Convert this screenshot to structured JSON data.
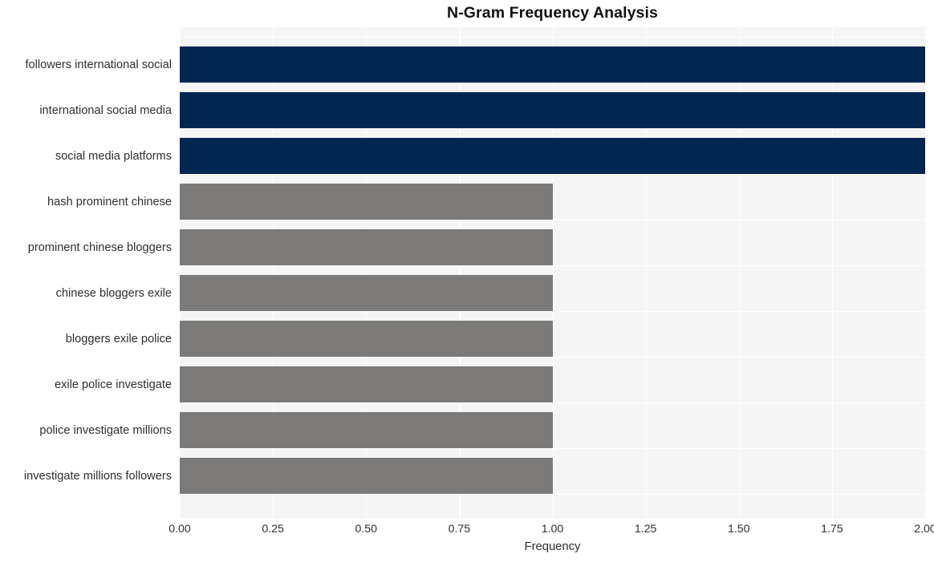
{
  "chart_data": {
    "type": "bar",
    "orientation": "horizontal",
    "title": "N-Gram Frequency Analysis",
    "xlabel": "Frequency",
    "ylabel": "",
    "categories": [
      "followers international social",
      "international social media",
      "social media platforms",
      "hash prominent chinese",
      "prominent chinese bloggers",
      "chinese bloggers exile",
      "bloggers exile police",
      "exile police investigate",
      "police investigate millions",
      "investigate millions followers"
    ],
    "values": [
      2,
      2,
      2,
      1,
      1,
      1,
      1,
      1,
      1,
      1
    ],
    "bar_colors": [
      "#002651",
      "#002651",
      "#002651",
      "#7b7a78",
      "#7b7a78",
      "#7b7a78",
      "#7b7a78",
      "#7b7a78",
      "#7b7a78",
      "#7b7a78"
    ],
    "xlim": [
      0,
      2
    ],
    "xticks": [
      0,
      0.25,
      0.5,
      0.75,
      1,
      1.25,
      1.5,
      1.75,
      2
    ],
    "xtick_labels": [
      "0.00",
      "0.25",
      "0.50",
      "0.75",
      "1.00",
      "1.25",
      "1.50",
      "1.75",
      "2.00"
    ],
    "grid": true,
    "grid_color": "#ffffff",
    "plot_background": "#f5f5f5",
    "figure_background": "#ffffff",
    "legend": null,
    "accent_color": "#002651",
    "secondary_color": "#7b7a78"
  }
}
